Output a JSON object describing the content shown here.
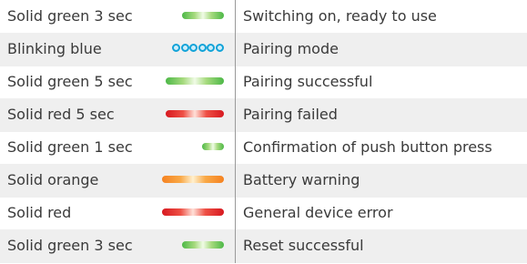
{
  "rows": [
    {
      "state": "Solid green 3 sec",
      "indicator": "green-led-bar",
      "meaning": "Switching on, ready to use"
    },
    {
      "state": "Blinking blue",
      "indicator": "blinking-blue-dots",
      "meaning": "Pairing mode"
    },
    {
      "state": "Solid green 5 sec",
      "indicator": "green-led-bar",
      "meaning": "Pairing successful"
    },
    {
      "state": "Solid red 5 sec",
      "indicator": "red-led-bar",
      "meaning": "Pairing failed"
    },
    {
      "state": "Solid green 1 sec",
      "indicator": "green-led-bar",
      "meaning": "Confirmation of push button press"
    },
    {
      "state": "Solid orange",
      "indicator": "orange-led-bar",
      "meaning": "Battery warning"
    },
    {
      "state": "Solid red",
      "indicator": "red-led-bar",
      "meaning": "General device error"
    },
    {
      "state": "Solid green 3 sec",
      "indicator": "green-led-bar",
      "meaning": "Reset successful"
    }
  ],
  "colors": {
    "green": "#4cb847",
    "blue": "#12a3d8",
    "red": "#d71920",
    "orange": "#f58220",
    "row_shade": "#efefef",
    "text": "#3a3a3a",
    "divider": "#9a9a9a"
  }
}
